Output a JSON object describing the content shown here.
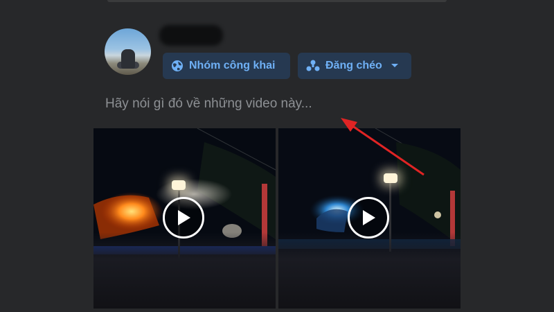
{
  "post": {
    "privacy_label": "Nhóm công khai",
    "crosspost_label": "Đăng chéo",
    "composer_placeholder": "Hãy nói gì đó về những video này..."
  },
  "icons": {
    "privacy": "globe-icon",
    "crosspost": "cross-post-icon",
    "dropdown": "caret-down-icon",
    "play": "play-icon"
  },
  "colors": {
    "background": "#27282a",
    "chip_bg": "#263951",
    "chip_text": "#6fb0f5",
    "placeholder_text": "#8d9094",
    "annotation_arrow": "#e02424"
  },
  "videos": [
    {
      "id": "video-1"
    },
    {
      "id": "video-2"
    }
  ]
}
